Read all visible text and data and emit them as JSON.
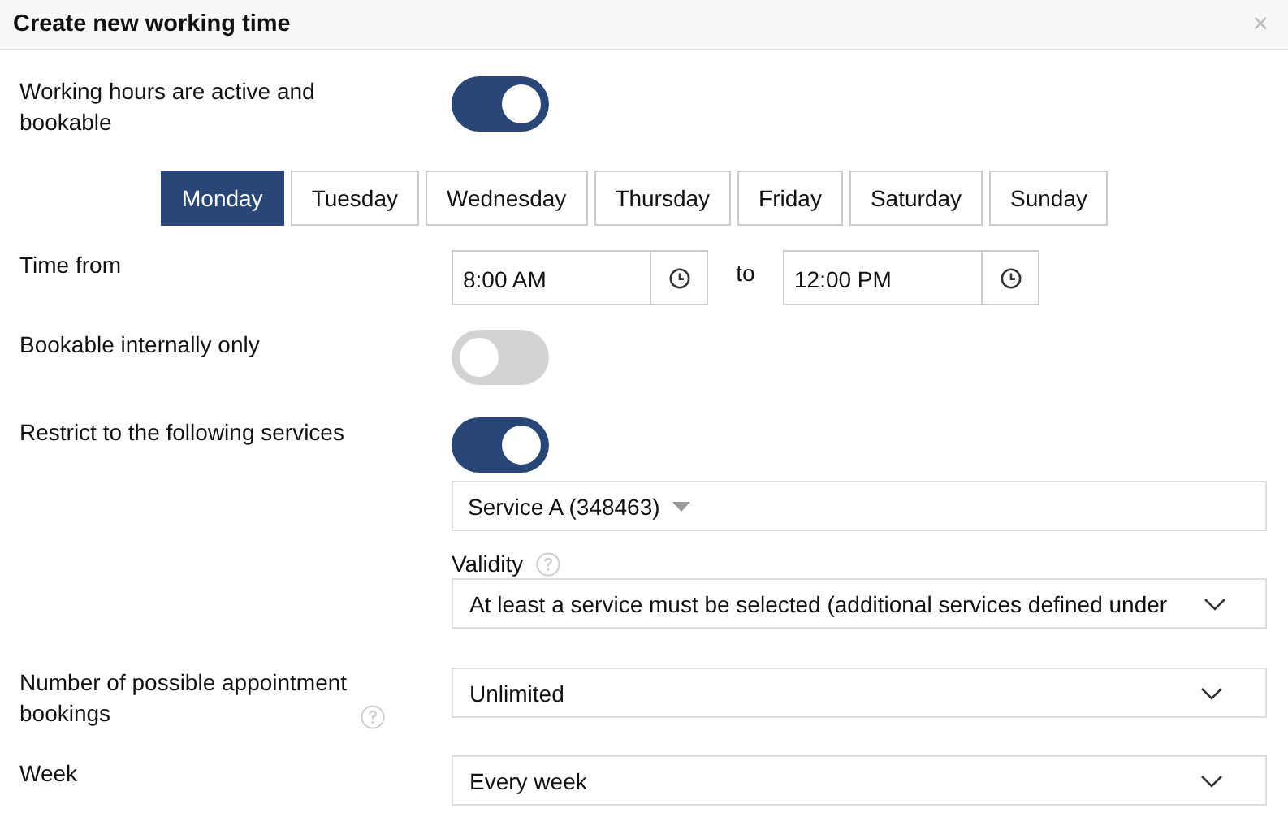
{
  "dialog": {
    "title": "Create new working time",
    "close": "×"
  },
  "active": {
    "label": "Working hours are active and bookable",
    "on": true
  },
  "days": [
    {
      "label": "Monday",
      "selected": true
    },
    {
      "label": "Tuesday",
      "selected": false
    },
    {
      "label": "Wednesday",
      "selected": false
    },
    {
      "label": "Thursday",
      "selected": false
    },
    {
      "label": "Friday",
      "selected": false
    },
    {
      "label": "Saturday",
      "selected": false
    },
    {
      "label": "Sunday",
      "selected": false
    }
  ],
  "time": {
    "label": "Time from",
    "from": "8:00 AM",
    "separator": "to",
    "to": "12:00 PM"
  },
  "internal": {
    "label": "Bookable internally only",
    "on": false
  },
  "restrict": {
    "label": "Restrict to the following services",
    "on": true,
    "service": "Service A (348463)",
    "validity_label": "Validity",
    "validity_value": "At least a service must be selected (additional services defined under"
  },
  "bookings": {
    "label": "Number of possible appointment bookings",
    "value": "Unlimited"
  },
  "week": {
    "label": "Week",
    "value": "Every week"
  }
}
